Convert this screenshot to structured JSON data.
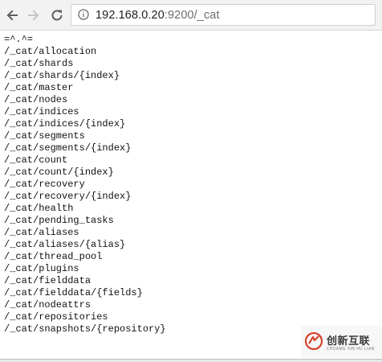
{
  "toolbar": {
    "back_icon": "arrow-left-icon",
    "forward_icon": "arrow-right-icon",
    "reload_icon": "reload-icon",
    "info_icon": "info-circle-icon",
    "address": {
      "host": "192.168.0.20",
      "rest": ":9200/_cat"
    }
  },
  "content": {
    "lines": [
      "=^.^=",
      "/_cat/allocation",
      "/_cat/shards",
      "/_cat/shards/{index}",
      "/_cat/master",
      "/_cat/nodes",
      "/_cat/indices",
      "/_cat/indices/{index}",
      "/_cat/segments",
      "/_cat/segments/{index}",
      "/_cat/count",
      "/_cat/count/{index}",
      "/_cat/recovery",
      "/_cat/recovery/{index}",
      "/_cat/health",
      "/_cat/pending_tasks",
      "/_cat/aliases",
      "/_cat/aliases/{alias}",
      "/_cat/thread_pool",
      "/_cat/plugins",
      "/_cat/fielddata",
      "/_cat/fielddata/{fields}",
      "/_cat/nodeattrs",
      "/_cat/repositories",
      "/_cat/snapshots/{repository}"
    ]
  },
  "watermark": {
    "text": "创新互联",
    "subtext": "CHUANG XIN HU LIAN",
    "color": "#d9412e"
  }
}
